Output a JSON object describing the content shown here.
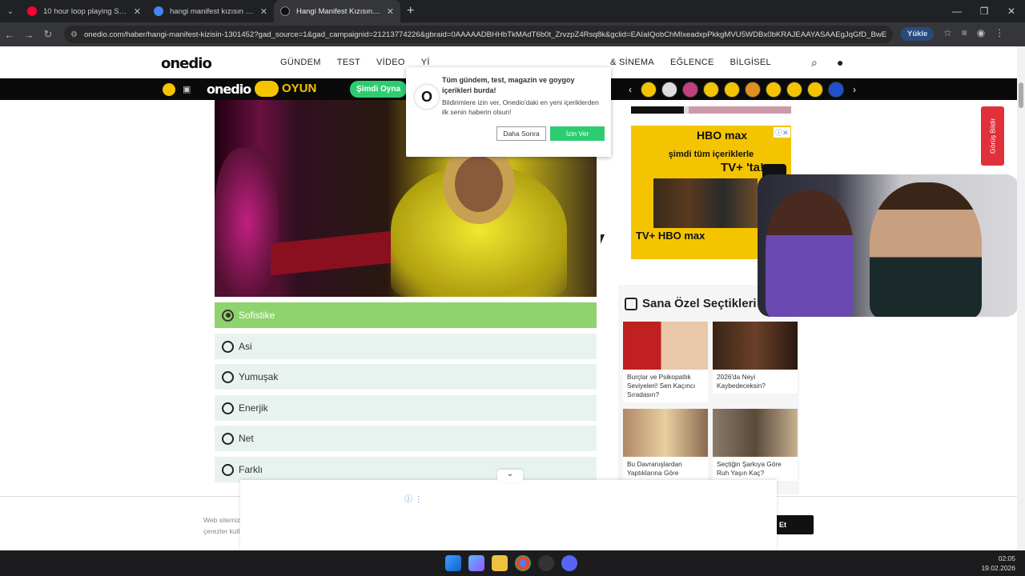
{
  "browser": {
    "tabs": [
      {
        "title": "10 hour loop playing Subway S",
        "favicon_color": "#ff0033"
      },
      {
        "title": "hangi manifest kızısın - Google",
        "favicon_color": "#4285f4"
      },
      {
        "title": "Hangi Manifest Kızısın? - Onedi",
        "favicon_color": "#111111"
      }
    ],
    "new_tab": "+",
    "url": "onedio.com/haber/hangi-manifest-kizisin-1301452?gad_source=1&gad_campaignid=21213774226&gbraid=0AAAAADBHHbTkMAdT6b0t_ZrvzpZ4Rsq8k&gclid=EAIaIQobChMIxeadxpPkkgMVU5WDBx0bKRAJEAAYASAAEgJqGfD_BwE",
    "upload_label": "Yükle"
  },
  "site": {
    "logo": "onedio",
    "nav": [
      "GÜNDEM",
      "TEST",
      "VİDEO",
      "Yİ"
    ],
    "nav_right": [
      "& SİNEMA",
      "EĞLENCE",
      "BİLGİSEL"
    ]
  },
  "promo": {
    "logo": "onedio",
    "game": "OYUN",
    "cta": "Şimdi Oyna"
  },
  "notification": {
    "title": "Tüm gündem, test, magazin ve goygoy içerikleri burda!",
    "body": "Bildirimlere izin ver, Onedio'daki en yeni içeriklerden ilk senin haberin olsun!",
    "later": "Daha Sonra",
    "allow": "İzin Ver"
  },
  "quiz": {
    "options": [
      {
        "label": "Sofistike",
        "selected": true
      },
      {
        "label": "Asi",
        "selected": false
      },
      {
        "label": "Yumuşak",
        "selected": false
      },
      {
        "label": "Enerjik",
        "selected": false
      },
      {
        "label": "Net",
        "selected": false
      },
      {
        "label": "Farklı",
        "selected": false
      }
    ]
  },
  "sidebar_ad": {
    "brand": "HBO max",
    "line1": "şimdi tüm içeriklerle",
    "line2": "TV+ 'ta!",
    "footer": "TV+ HBO max"
  },
  "picks": {
    "title": "Sana Özel Seçtikleri",
    "cards": [
      {
        "text": "Burçlar ve Psikopatlık Seviyeleri! Sen Kaçıncı Sıradasın?",
        "thumb": "#8a2a2a"
      },
      {
        "text": "2026'da Neyi Kaybedeceksin?",
        "thumb": "#4a2a1a"
      },
      {
        "text": "Bu Davranışlardan Yaptıklarına Göre",
        "thumb": "#a08060"
      },
      {
        "text": "Seçtiğin Şarkıya Göre Ruh Yaşın Kaç?",
        "thumb": "#6a5a4a"
      }
    ]
  },
  "feedback": "Görüş Bildir",
  "cookie": {
    "text": "Web sitemiz çerezler kull",
    "button": "Et"
  },
  "taskbar": {
    "time": "02:05",
    "date": "19.02.2026"
  }
}
